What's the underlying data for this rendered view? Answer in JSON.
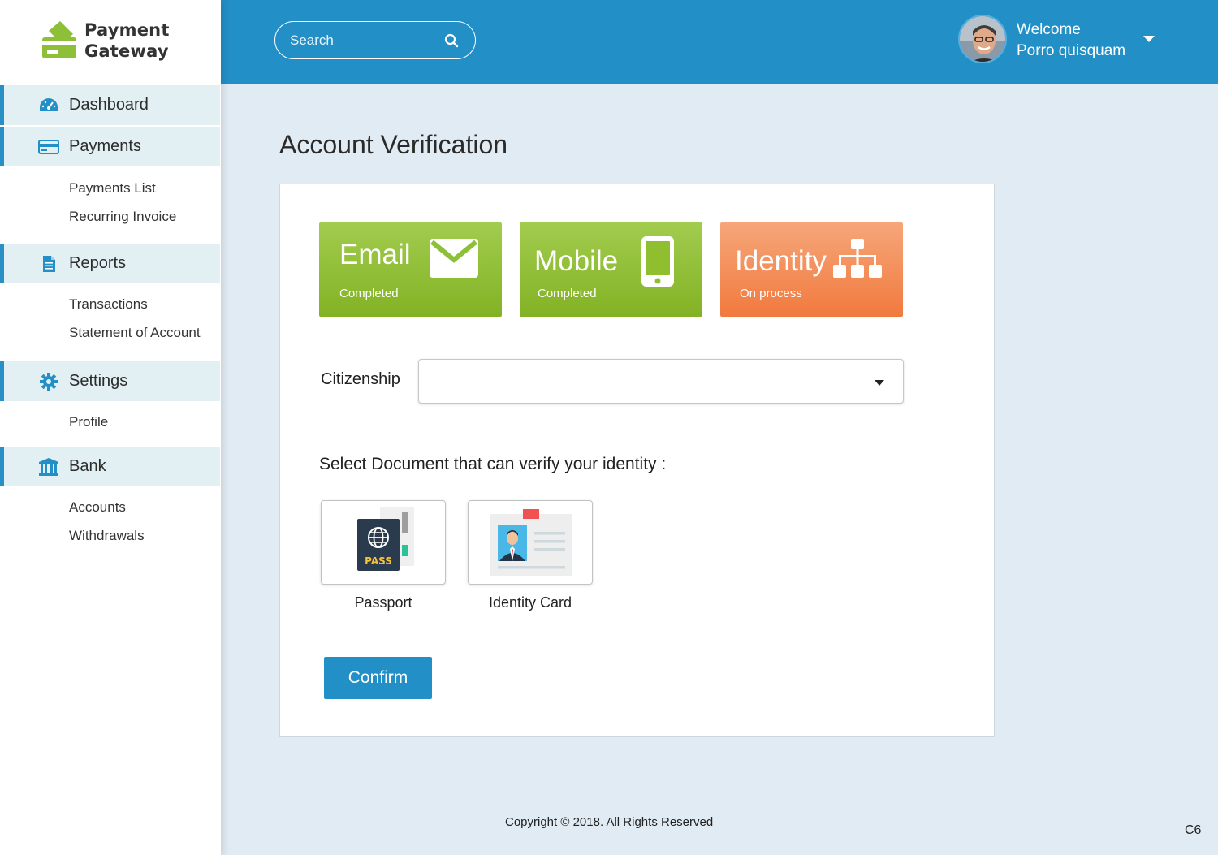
{
  "app": {
    "logo_line1": "Payment",
    "logo_line2": "Gateway",
    "brand_color": "#2290c6",
    "accent_green": "#8dc038",
    "accent_orange": "#f38a4f"
  },
  "header": {
    "search_placeholder": "Search",
    "welcome": "Welcome",
    "user_name": "Porro quisquam"
  },
  "sidebar": {
    "sections": [
      {
        "label": "Dashboard",
        "icon": "dashboard-gauge-icon"
      },
      {
        "label": "Payments",
        "icon": "credit-card-icon",
        "items": [
          "Payments List",
          "Recurring Invoice"
        ]
      },
      {
        "label": "Reports",
        "icon": "document-icon",
        "items": [
          "Transactions",
          "Statement of Account"
        ]
      },
      {
        "label": "Settings",
        "icon": "gear-icon",
        "items": [
          "Profile"
        ]
      },
      {
        "label": "Bank",
        "icon": "bank-icon",
        "items": [
          "Accounts",
          "Withdrawals"
        ]
      }
    ]
  },
  "main": {
    "title": "Account Verification",
    "steps": [
      {
        "title": "Email",
        "status": "Completed",
        "icon": "envelope-icon"
      },
      {
        "title": "Mobile",
        "status": "Completed",
        "icon": "mobile-phone-icon"
      },
      {
        "title": "Identity",
        "status": "On process",
        "icon": "sitemap-icon"
      }
    ],
    "citizenship_label": "Citizenship",
    "citizenship_value": "",
    "doc_prompt": "Select Document that can verify your identity :",
    "documents": [
      {
        "label": "Passport",
        "icon": "passport-icon",
        "badge": "PASS"
      },
      {
        "label": "Identity Card",
        "icon": "id-card-icon"
      }
    ],
    "confirm_label": "Confirm"
  },
  "footer": {
    "copyright": "Copyright © 2018. All Rights Reserved",
    "corner_code": "C6"
  }
}
